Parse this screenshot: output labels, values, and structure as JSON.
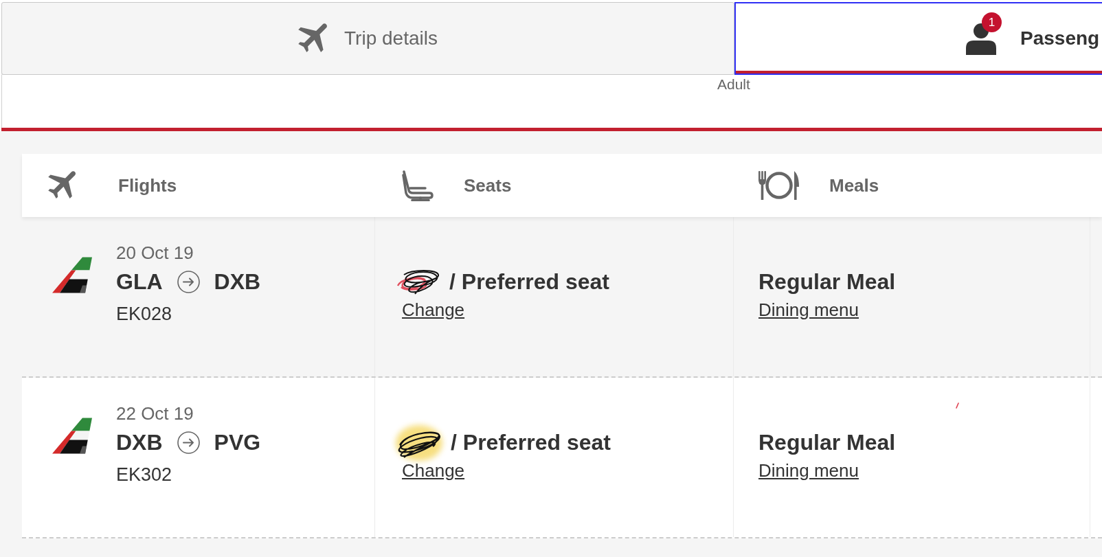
{
  "tabs": [
    {
      "label": "Trip details",
      "kind": "trip",
      "selected": false
    },
    {
      "label": "Passeng",
      "kind": "passengers",
      "badge": "1",
      "subtitle": "Adult",
      "selected": true
    }
  ],
  "itinerary": {
    "columns": [
      {
        "label": "Flights",
        "kind": "flights"
      },
      {
        "label": "Seats",
        "kind": "seats"
      },
      {
        "label": "Meals",
        "kind": "meals"
      }
    ],
    "rows": [
      {
        "date": "20 Oct 19",
        "origin": "GLA",
        "destination": "DXB",
        "flight_number": "EK028",
        "seat": {
          "label": "/ Preferred seat",
          "kind": "scribble",
          "link": "Change"
        },
        "meal": {
          "label": "Regular Meal",
          "link": "Dining menu"
        }
      },
      {
        "date": "22 Oct 19",
        "origin": "DXB",
        "destination": "PVG",
        "flight_number": "EK302",
        "seat": {
          "label": "/ Preferred seat",
          "kind": "highlight",
          "link": "Change"
        },
        "meal": {
          "label": "Regular Meal",
          "link": "Dining menu"
        }
      }
    ]
  }
}
